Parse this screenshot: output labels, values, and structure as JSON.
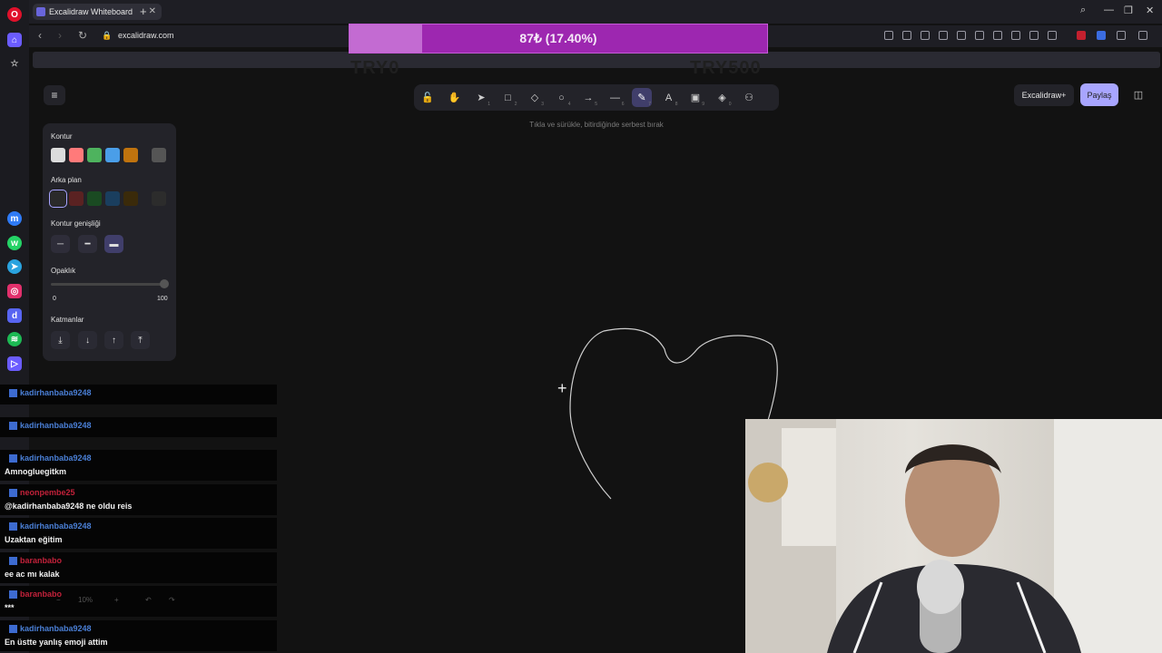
{
  "browser": {
    "tab_title": "Excalidraw Whiteboard",
    "url": "excalidraw.com"
  },
  "overlay": {
    "donation_text": "87₺ (17.40%)",
    "donation_progress": 0.174,
    "goal_start": "TRY0",
    "goal_end": "TRY500"
  },
  "toolbar": {
    "tools": [
      {
        "name": "lock",
        "glyph": "🔓",
        "key": ""
      },
      {
        "name": "hand",
        "glyph": "✋",
        "key": ""
      },
      {
        "name": "selection",
        "glyph": "➤",
        "key": "1"
      },
      {
        "name": "rectangle",
        "glyph": "□",
        "key": "2"
      },
      {
        "name": "diamond",
        "glyph": "◇",
        "key": "3"
      },
      {
        "name": "ellipse",
        "glyph": "○",
        "key": "4"
      },
      {
        "name": "arrow",
        "glyph": "→",
        "key": "5"
      },
      {
        "name": "line",
        "glyph": "—",
        "key": "6"
      },
      {
        "name": "draw",
        "glyph": "✎",
        "key": "7"
      },
      {
        "name": "text",
        "glyph": "A",
        "key": "8"
      },
      {
        "name": "image",
        "glyph": "▣",
        "key": "9"
      },
      {
        "name": "eraser",
        "glyph": "◈",
        "key": "0"
      },
      {
        "name": "more",
        "glyph": "⚇",
        "key": ""
      }
    ],
    "hint": "Tıkla ve sürükle, bitirdiğinde serbest bırak",
    "plus_label": "Excalidraw+",
    "share_label": "Paylaş"
  },
  "props": {
    "stroke_label": "Kontur",
    "stroke_colors": [
      "#dcdcdc",
      "#ff7a7a",
      "#4eb35e",
      "#4a9ee8",
      "#c0730e"
    ],
    "stroke_current": "#555555",
    "bg_label": "Arka plan",
    "bg_colors": [
      "#2a2a2a",
      "#5a2222",
      "#1a4a22",
      "#1a3e5e",
      "#3a2a0a"
    ],
    "width_label": "Kontur genişliği",
    "opacity_label": "Opaklık",
    "opacity_min": "0",
    "opacity_max": "100",
    "opacity_value": 100,
    "layers_label": "Katmanlar"
  },
  "chat": [
    {
      "name": "kadirhanbaba9248",
      "msg": ""
    },
    {
      "name": "kadirhanbaba9248",
      "msg": ""
    },
    {
      "name": "kadirhanbaba9248",
      "msg": "Amnogluegitkm"
    },
    {
      "name": "neonpembe25",
      "msg": "@kadirhanbaba9248 ne oldu reis"
    },
    {
      "name": "kadirhanbaba9248",
      "msg": "Uzaktan eğitim"
    },
    {
      "name": "baranbabo",
      "msg": "ee ac mı kalak"
    },
    {
      "name": "baranbabo",
      "msg": "***"
    },
    {
      "name": "kadirhanbaba9248",
      "msg": "En üstte yanlış emoji attim"
    }
  ],
  "zoom": "10%"
}
